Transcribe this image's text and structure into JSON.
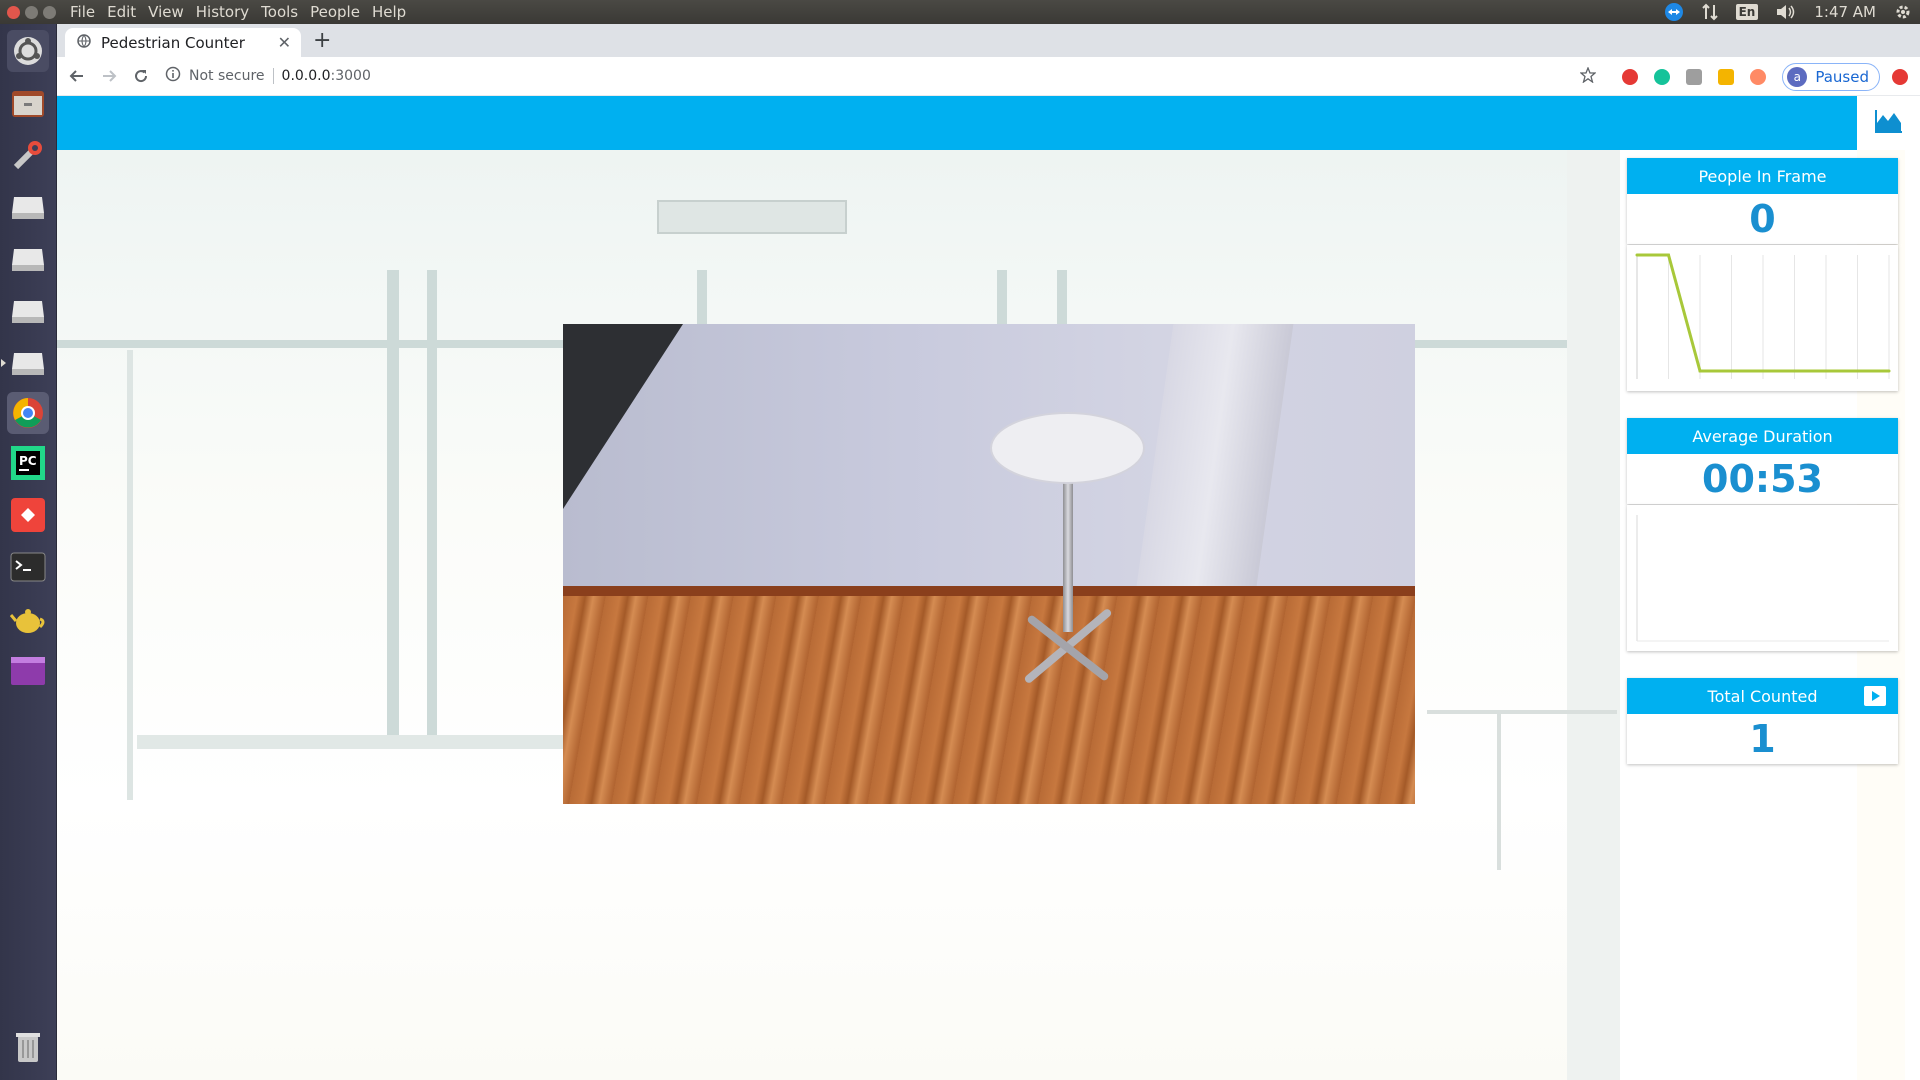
{
  "os_panel": {
    "menu": [
      "File",
      "Edit",
      "View",
      "History",
      "Tools",
      "People",
      "Help"
    ],
    "keyboard_layout": "En",
    "time": "1:47 AM"
  },
  "browser": {
    "tab_title": "Pedestrian Counter",
    "security_label": "Not secure",
    "url_host": "0.0.0.0",
    "url_port": ":3000",
    "profile_initial": "a",
    "profile_status": "Paused"
  },
  "launcher": {
    "items": [
      "ubuntu-dash-icon",
      "files-icon",
      "settings-tool-icon",
      "drive-icon",
      "drive-icon",
      "drive-icon",
      "drive-icon",
      "chrome-icon",
      "pycharm-icon",
      "anydesk-icon",
      "terminal-icon",
      "teapot-icon",
      "window-app-icon",
      "trash-icon"
    ]
  },
  "colors": {
    "accent": "#00b0f0",
    "value_blue": "#1a8fd0",
    "chart_line": "#a8c83a"
  },
  "stats": {
    "people_in_frame": {
      "label": "People In Frame",
      "value": "0"
    },
    "average_duration": {
      "label": "Average Duration",
      "value": "00:53"
    },
    "total_counted": {
      "label": "Total Counted",
      "value": "1"
    }
  },
  "people_chart": {
    "values": [
      1,
      1,
      0,
      0,
      0,
      0,
      0,
      0,
      0
    ],
    "ylim": [
      0,
      1
    ]
  }
}
